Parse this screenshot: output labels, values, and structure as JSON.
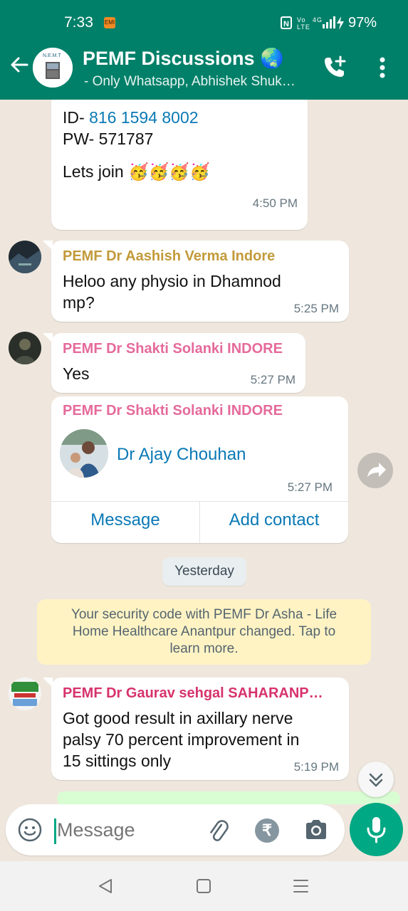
{
  "status_bar": {
    "time": "7:33",
    "notification_badge": "EMI",
    "signal_icons": "N Vo LTE ⁴ᴳ↗ ▐",
    "battery": "97%"
  },
  "header": {
    "title": "PEMF Discussions 🌏",
    "subtitle": "- Only Whatsapp, Abhishek Shuk…"
  },
  "messages": [
    {
      "id_label": "ID- ",
      "id_value": "816 1594 8002",
      "pw": "PW- 571787",
      "text": "Lets join 🥳🥳🥳🥳",
      "time": "4:50 PM"
    },
    {
      "sender": "PEMF Dr Aashish Verma Indore",
      "sender_color": "#c29a3a",
      "text_line1": "Heloo any physio in Dhamnod",
      "text_line2": "mp?",
      "time": "5:25 PM"
    },
    {
      "sender": "PEMF Dr Shakti Solanki INDORE",
      "sender_color": "#e56a9b",
      "text": "Yes",
      "time": "5:27 PM"
    },
    {
      "sender": "PEMF Dr Shakti Solanki INDORE",
      "contact_name": "Dr Ajay Chouhan",
      "time": "5:27 PM",
      "action_message": "Message",
      "action_add": "Add contact"
    },
    {
      "sender": "PEMF Dr Gaurav sehgal SAHARANP…",
      "sender_color": "#d6336c",
      "text_line1": "Got good result in axillary nerve",
      "text_line2": "palsy 70 percent improvement in",
      "text_line3": "15 sittings only",
      "time": "5:19 PM"
    }
  ],
  "date_divider": "Yesterday",
  "system_message": {
    "line1": "Your security code with PEMF Dr Asha - Life",
    "line2": "Home Healthcare Anantpur changed. Tap to",
    "line3": "learn more."
  },
  "composer": {
    "placeholder": "Message",
    "rupee_symbol": "₹"
  },
  "colors": {
    "brand": "#008069",
    "accent": "#00a884",
    "link": "#0a79b5"
  }
}
